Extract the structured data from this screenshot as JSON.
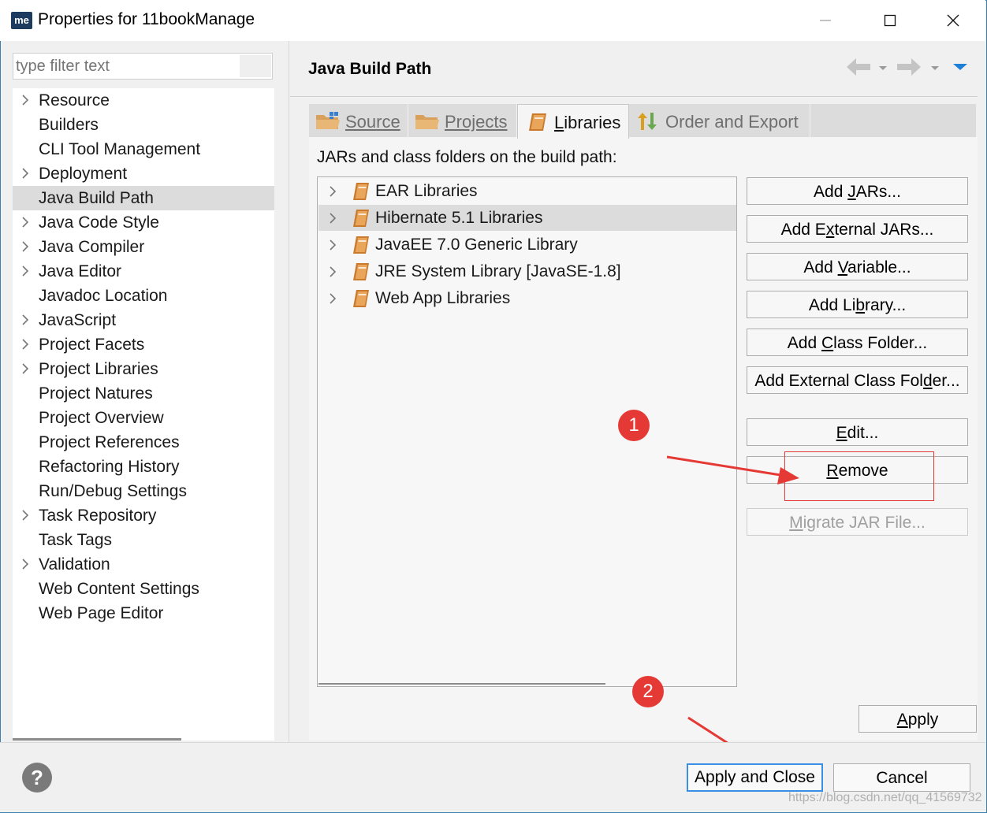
{
  "window": {
    "app_icon_text": "me",
    "title": "Properties for 11bookManage"
  },
  "filter": {
    "placeholder": "type filter text"
  },
  "nav": {
    "items": [
      {
        "label": "Resource",
        "expandable": true
      },
      {
        "label": "Builders",
        "expandable": false
      },
      {
        "label": "CLI Tool Management",
        "expandable": false
      },
      {
        "label": "Deployment",
        "expandable": true
      },
      {
        "label": "Java Build Path",
        "expandable": false,
        "selected": true
      },
      {
        "label": "Java Code Style",
        "expandable": true
      },
      {
        "label": "Java Compiler",
        "expandable": true
      },
      {
        "label": "Java Editor",
        "expandable": true
      },
      {
        "label": "Javadoc Location",
        "expandable": false
      },
      {
        "label": "JavaScript",
        "expandable": true
      },
      {
        "label": "Project Facets",
        "expandable": true
      },
      {
        "label": "Project Libraries",
        "expandable": true
      },
      {
        "label": "Project Natures",
        "expandable": false
      },
      {
        "label": "Project Overview",
        "expandable": false
      },
      {
        "label": "Project References",
        "expandable": false
      },
      {
        "label": "Refactoring History",
        "expandable": false
      },
      {
        "label": "Run/Debug Settings",
        "expandable": false
      },
      {
        "label": "Task Repository",
        "expandable": true
      },
      {
        "label": "Task Tags",
        "expandable": false
      },
      {
        "label": "Validation",
        "expandable": true
      },
      {
        "label": "Web Content Settings",
        "expandable": false
      },
      {
        "label": "Web Page Editor",
        "expandable": false
      }
    ]
  },
  "page": {
    "title": "Java Build Path"
  },
  "tabs": [
    {
      "label": "Source",
      "icon": "folder-icon"
    },
    {
      "label": "Projects",
      "icon": "folder-icon"
    },
    {
      "label": "Libraries",
      "icon": "library-icon",
      "active": true
    },
    {
      "label": "Order and Export",
      "icon": "order-arrows-icon"
    }
  ],
  "libraries": {
    "section_label": "JARs and class folders on the build path:",
    "items": [
      {
        "label": "EAR Libraries"
      },
      {
        "label": "Hibernate 5.1 Libraries",
        "selected": true
      },
      {
        "label": "JavaEE 7.0 Generic Library"
      },
      {
        "label": "JRE System Library [JavaSE-1.8]"
      },
      {
        "label": "Web App Libraries"
      }
    ]
  },
  "buttons": {
    "add_jars": {
      "pre": "Add ",
      "u": "J",
      "post": "ARs..."
    },
    "add_external_jars": {
      "pre": "Add E",
      "u": "x",
      "post": "ternal JARs..."
    },
    "add_variable": {
      "pre": "Add ",
      "u": "V",
      "post": "ariable..."
    },
    "add_library": {
      "pre": "Add Li",
      "u": "b",
      "post": "rary..."
    },
    "add_class_folder": {
      "pre": "Add ",
      "u": "C",
      "post": "lass Folder..."
    },
    "add_external_class_folder": {
      "pre": "Add External Class Fol",
      "u": "d",
      "post": "er..."
    },
    "edit": {
      "pre": "",
      "u": "E",
      "post": "dit..."
    },
    "remove": {
      "pre": "",
      "u": "R",
      "post": "emove"
    },
    "migrate": {
      "pre": "",
      "u": "M",
      "post": "igrate JAR File..."
    },
    "apply": {
      "pre": "",
      "u": "A",
      "post": "pply"
    }
  },
  "annotations": {
    "step1": "1",
    "step2": "2",
    "color": "#e53935"
  },
  "footer": {
    "help_glyph": "?",
    "apply_and_close": "Apply and Close",
    "cancel": "Cancel"
  },
  "watermark": "https://blog.csdn.net/qq_41569732",
  "colors": {
    "accent": "#3a8ee6",
    "library_icon": "#d4873a",
    "selection": "#dcdcdc"
  }
}
